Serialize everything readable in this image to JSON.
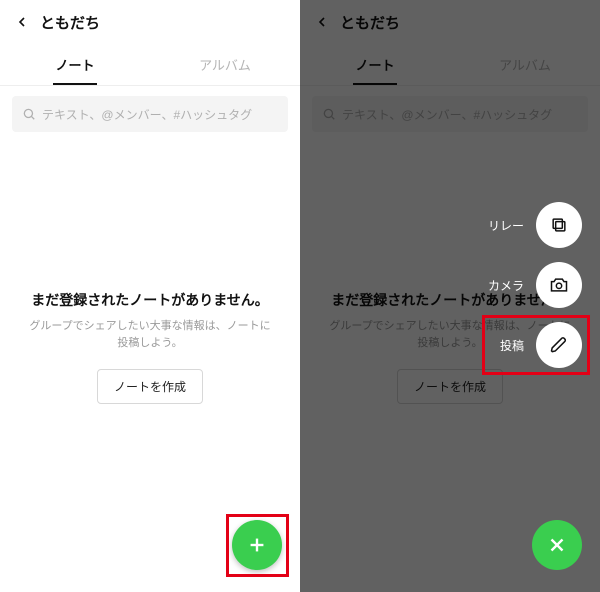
{
  "header": {
    "title": "ともだち"
  },
  "tabs": {
    "note": "ノート",
    "album": "アルバム"
  },
  "search": {
    "placeholder": "テキスト、@メンバー、#ハッシュタグ"
  },
  "empty": {
    "title": "まだ登録されたノートがありません。",
    "sub": "グループでシェアしたい大事な情報は、ノートに\n投稿しよう。",
    "create": "ノートを作成"
  },
  "fab": {
    "relay": "リレー",
    "camera": "カメラ",
    "post": "投稿"
  },
  "colors": {
    "accent": "#3ace4f",
    "highlight": "#e30016"
  }
}
